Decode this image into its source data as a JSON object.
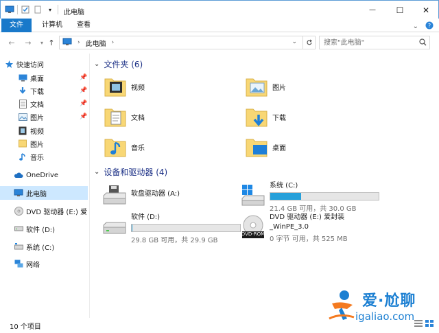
{
  "window": {
    "title": "此电脑",
    "controls": {
      "minimize": "—",
      "maximize": "☐",
      "close": "✕"
    }
  },
  "ribbon": {
    "tabs": [
      "文件",
      "计算机",
      "查看"
    ]
  },
  "address": {
    "crumb": "此电脑",
    "search_placeholder": "搜索\"此电脑\""
  },
  "nav": {
    "quick_access": "快速访问",
    "quick_items": [
      {
        "label": "桌面",
        "icon": "desktop-icon",
        "pinned": true
      },
      {
        "label": "下载",
        "icon": "download-icon",
        "pinned": true
      },
      {
        "label": "文档",
        "icon": "document-icon",
        "pinned": true
      },
      {
        "label": "图片",
        "icon": "picture-icon",
        "pinned": true
      },
      {
        "label": "视频",
        "icon": "video-icon",
        "pinned": false
      },
      {
        "label": "图片",
        "icon": "folder-icon",
        "pinned": false
      },
      {
        "label": "音乐",
        "icon": "music-icon",
        "pinned": false
      }
    ],
    "onedrive": "OneDrive",
    "this_pc": "此电脑",
    "dvd": "DVD 驱动器 (E:) 爱",
    "soft": "软件 (D:)",
    "system": "系统 (C:)",
    "network": "网络"
  },
  "folders_group": {
    "title": "文件夹 (6)",
    "items": [
      {
        "label": "视频",
        "icon": "video-folder-icon"
      },
      {
        "label": "图片",
        "icon": "picture-folder-icon"
      },
      {
        "label": "文档",
        "icon": "document-folder-icon"
      },
      {
        "label": "下载",
        "icon": "download-folder-icon"
      },
      {
        "label": "音乐",
        "icon": "music-folder-icon"
      },
      {
        "label": "桌面",
        "icon": "desktop-folder-icon"
      }
    ]
  },
  "drives_group": {
    "title": "设备和驱动器 (4)",
    "items": [
      {
        "name": "软盘驱动器 (A:)",
        "icon": "floppy-drive-icon",
        "has_bar": false,
        "used_fraction": null,
        "capacity": ""
      },
      {
        "name": "系统 (C:)",
        "icon": "system-drive-icon",
        "has_bar": true,
        "used_fraction": 0.287,
        "capacity": "21.4 GB 可用，共 30.0 GB"
      },
      {
        "name": "软件 (D:)",
        "icon": "hard-drive-icon",
        "has_bar": true,
        "used_fraction": 0.003,
        "capacity": "29.8 GB 可用，共 29.9 GB"
      },
      {
        "name": "DVD 驱动器 (E:) 爱封装",
        "name2": "_WinPE_3.0",
        "icon": "dvd-drive-icon",
        "dvd_label": "DVD-ROM",
        "has_bar": false,
        "used_fraction": null,
        "capacity": "0 字节 可用，共 525 MB"
      }
    ]
  },
  "status": {
    "count": "10 个项目"
  },
  "watermark": {
    "title": "爱·尬聊",
    "url": "igaliao.com"
  },
  "colors": {
    "accent": "#1979ca",
    "selected": "#cde8ff",
    "bar_fill": "#26a0da",
    "group_title": "#1e3287"
  }
}
